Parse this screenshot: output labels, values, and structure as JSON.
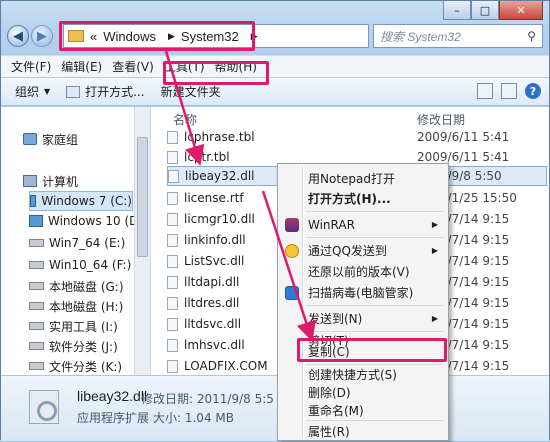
{
  "address": {
    "crumb_prefix": "«",
    "segments": [
      "Windows",
      "System32"
    ],
    "search_placeholder": "搜索 System32"
  },
  "menubar": [
    "文件(F)",
    "编辑(E)",
    "查看(V)",
    "工具(T)",
    "帮助(H)"
  ],
  "toolbar": {
    "organize": "组织",
    "open_with": "打开方式...",
    "new_folder": "新建文件夹"
  },
  "nav_pane": {
    "items": [
      {
        "label": "家庭组"
      },
      {
        "label": "计算机"
      },
      {
        "label": "Windows 7 (C:)"
      },
      {
        "label": "Windows 10 (D:)"
      },
      {
        "label": "Win7_64 (E:)"
      },
      {
        "label": "Win10_64 (F:)"
      },
      {
        "label": "本地磁盘 (G:)"
      },
      {
        "label": "本地磁盘 (H:)"
      },
      {
        "label": "实用工具 (I:)"
      },
      {
        "label": "软件分类 (J:)"
      },
      {
        "label": "文件分类 (K:)"
      }
    ]
  },
  "file_list": {
    "col_name": "名称",
    "col_date": "修改日期",
    "rows": [
      {
        "name": "lcphrase.tbl",
        "date": "2009/6/11 5:41"
      },
      {
        "name": "lcptr.tbl",
        "date": "2009/6/11 5:41"
      },
      {
        "name": "libeay32.dll",
        "date": "2011/9/8 5:50"
      },
      {
        "name": "license.rtf",
        "date": "2009/1/25 15:50"
      },
      {
        "name": "licmgr10.dll",
        "date": "2009/7/14 9:15"
      },
      {
        "name": "linkinfo.dll",
        "date": "2009/7/14 9:15"
      },
      {
        "name": "ListSvc.dll",
        "date": "2009/7/14 9:15"
      },
      {
        "name": "lltdapi.dll",
        "date": "2009/7/14 9:15"
      },
      {
        "name": "lltdres.dll",
        "date": "2009/7/14 9:15"
      },
      {
        "name": "lltdsvc.dll",
        "date": "2009/7/14 9:15"
      },
      {
        "name": "lmhsvc.dll",
        "date": "2009/7/14 9:15"
      },
      {
        "name": "LOADFIX.COM",
        "date": "2009/7/14 9:15"
      }
    ]
  },
  "context_menu": {
    "items": [
      {
        "label": "用Notepad打开"
      },
      {
        "label": "打开方式(H)..."
      },
      {
        "label": "WinRAR"
      },
      {
        "label": "通过QQ发送到"
      },
      {
        "label": "还原以前的版本(V)"
      },
      {
        "label": "扫描病毒(电脑管家)"
      },
      {
        "label": "发送到(N)"
      },
      {
        "label": "剪切(T)"
      },
      {
        "label": "复制(C)"
      },
      {
        "label": "创建快捷方式(S)"
      },
      {
        "label": "删除(D)"
      },
      {
        "label": "重命名(M)"
      },
      {
        "label": "属性(R)"
      }
    ]
  },
  "status": {
    "name": "libeay32.dll",
    "modified": "修改日期: 2011/9/8 5:5",
    "type": "应用程序扩展",
    "size": "大小: 1.04 MB"
  },
  "colors": {
    "highlight": "#e0196b",
    "selection": "#dbe9f8"
  }
}
